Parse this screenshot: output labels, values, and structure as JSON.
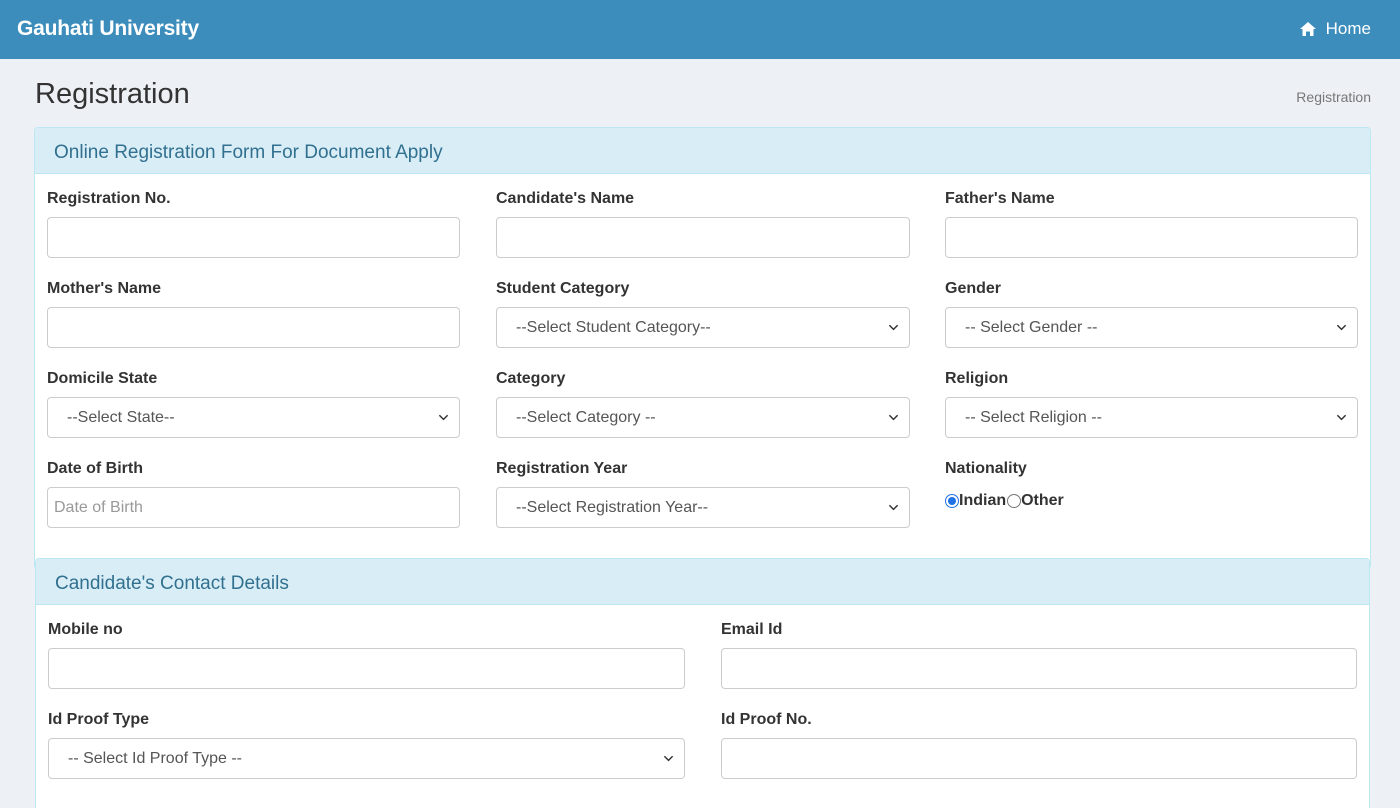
{
  "header": {
    "brand": "Gauhati University",
    "home_label": "Home"
  },
  "page": {
    "title": "Registration",
    "breadcrumb": "Registration"
  },
  "section1": {
    "heading": "Online Registration Form For Document Apply",
    "registration_no": {
      "label": "Registration No.",
      "value": ""
    },
    "candidate_name": {
      "label": "Candidate's Name",
      "value": ""
    },
    "father_name": {
      "label": "Father's Name",
      "value": ""
    },
    "mother_name": {
      "label": "Mother's Name",
      "value": ""
    },
    "student_category": {
      "label": "Student Category",
      "selected": "--Select Student Category--"
    },
    "gender": {
      "label": "Gender",
      "selected": "-- Select Gender --"
    },
    "domicile_state": {
      "label": "Domicile State",
      "selected": "--Select State--"
    },
    "category": {
      "label": "Category",
      "selected": "--Select Category --"
    },
    "religion": {
      "label": "Religion",
      "selected": "-- Select Religion --"
    },
    "dob": {
      "label": "Date of Birth",
      "placeholder": "Date of Birth",
      "value": ""
    },
    "registration_year": {
      "label": "Registration Year",
      "selected": "--Select Registration Year--"
    },
    "nationality": {
      "label": "Nationality",
      "options": [
        "Indian",
        "Other"
      ],
      "selected": "Indian"
    }
  },
  "section2": {
    "heading": "Candidate's Contact Details",
    "mobile": {
      "label": "Mobile no",
      "value": ""
    },
    "email": {
      "label": "Email Id",
      "value": ""
    },
    "id_proof_type": {
      "label": "Id Proof Type",
      "selected": "-- Select Id Proof Type --"
    },
    "id_proof_no": {
      "label": "Id Proof No.",
      "value": ""
    }
  },
  "colors": {
    "navbar": "#3c8dbc",
    "panel_heading_bg": "#d9edf7",
    "panel_heading_text": "#31708f",
    "page_bg": "#edf0f5"
  },
  "icons": {
    "home": "home-icon",
    "select_arrow": "chevron-down-icon"
  }
}
